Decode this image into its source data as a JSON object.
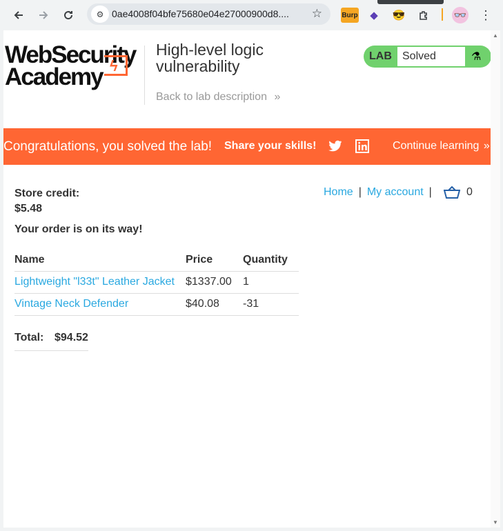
{
  "browser": {
    "url": "0ae4008f04bfe75680e04e27000900d8....",
    "back_icon": "arrow-left",
    "forward_icon": "arrow-right",
    "reload_icon": "reload",
    "extensions": [
      "burp-icon",
      "purple-extension-icon",
      "emoji-extension-icon",
      "puzzle-icon",
      "profile-icon",
      "menu-icon"
    ]
  },
  "header": {
    "logo_line1": "WebSecurity",
    "logo_line2": "Academy",
    "lab_title": "High-level logic vulnerability",
    "back_link": "Back to lab description",
    "lab_tag": "LAB",
    "lab_status": "Solved"
  },
  "banner": {
    "message": "Congratulations, you solved the lab!",
    "share": "Share your skills!",
    "continue": "Continue learning"
  },
  "account": {
    "store_credit_label": "Store credit:",
    "store_credit_value": "$5.48",
    "nav_home": "Home",
    "nav_account": "My account",
    "cart_count": "0"
  },
  "order": {
    "message": "Your order is on its way!",
    "columns": [
      "Name",
      "Price",
      "Quantity"
    ],
    "rows": [
      {
        "name": "Lightweight \"l33t\" Leather Jacket",
        "price": "$1337.00",
        "quantity": "1"
      },
      {
        "name": "Vintage Neck Defender",
        "price": "$40.08",
        "quantity": "-31"
      }
    ],
    "total_label": "Total:",
    "total_value": "$94.52"
  },
  "colors": {
    "accent": "#ff6633",
    "link": "#29a8e0",
    "solved_green": "#70d16d"
  }
}
